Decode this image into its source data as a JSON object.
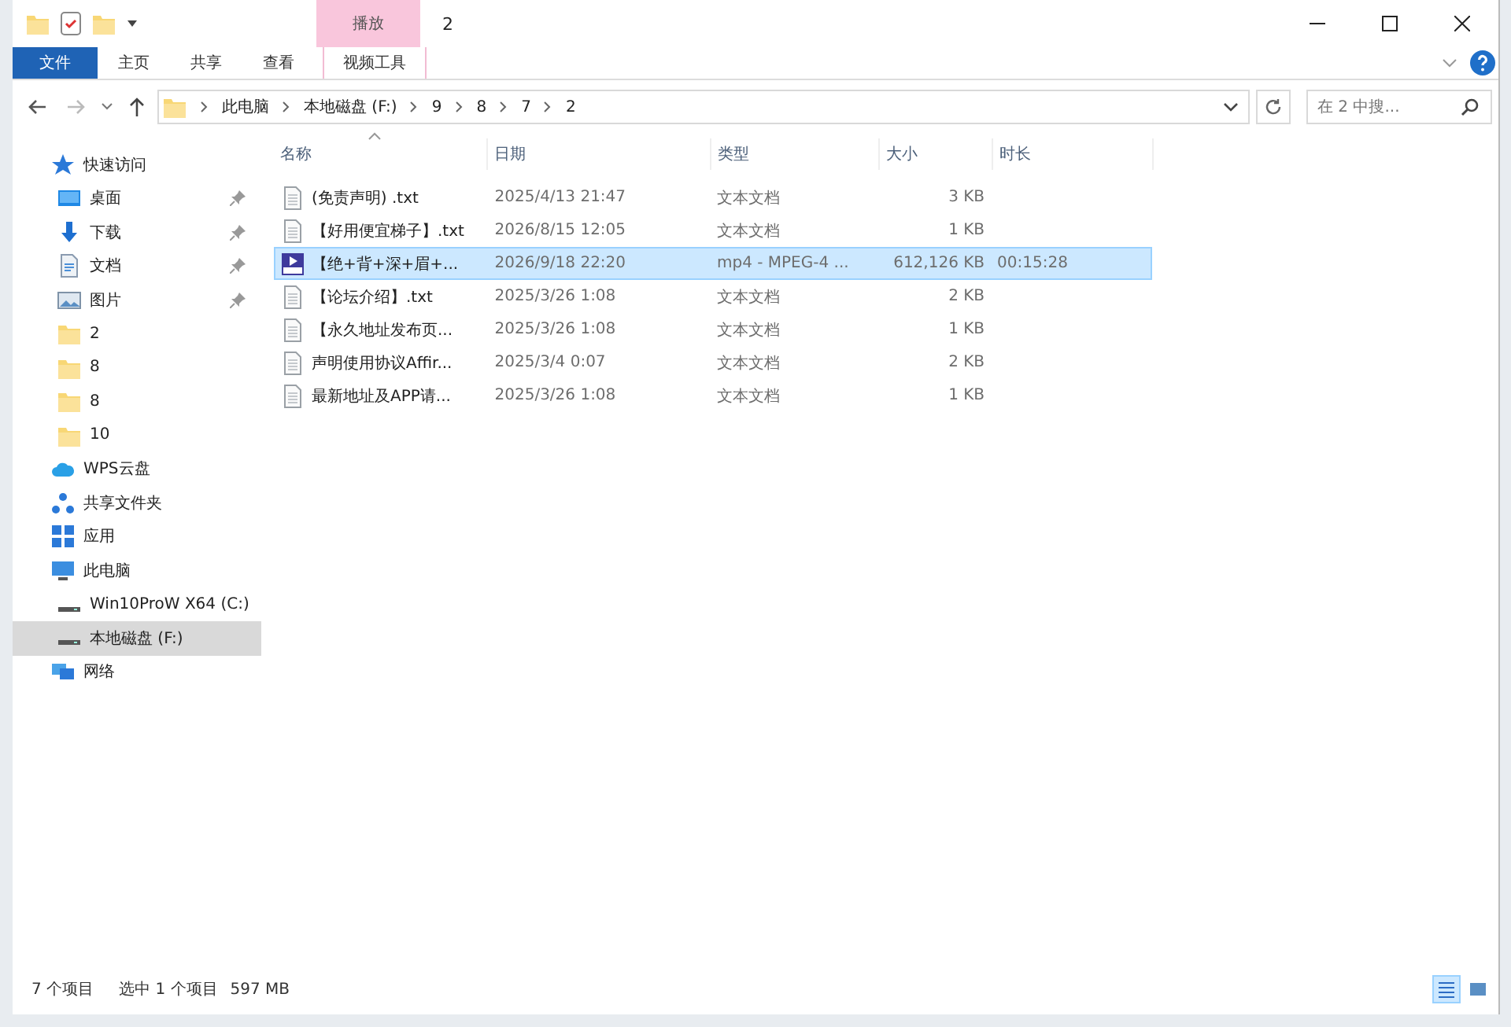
{
  "window": {
    "title": "2",
    "contextual_tab_group": "播放"
  },
  "ribbon_tabs": [
    {
      "label": "文件",
      "kind": "file",
      "selected": false
    },
    {
      "label": "主页",
      "kind": "tab",
      "selected": false
    },
    {
      "label": "共享",
      "kind": "tab",
      "selected": false
    },
    {
      "label": "查看",
      "kind": "tab",
      "selected": false
    },
    {
      "label": "视频工具",
      "kind": "contextual",
      "selected": false
    }
  ],
  "address_bar": {
    "path": [
      "此电脑",
      "本地磁盘 (F:)",
      "9",
      "8",
      "7",
      "2"
    ]
  },
  "search": {
    "placeholder": "在 2 中搜..."
  },
  "sidebar": {
    "items": [
      {
        "label": "快速访问",
        "kind": "star",
        "selected": false,
        "children": [
          {
            "label": "桌面",
            "kind": "desktop",
            "pinned": true,
            "selected": false
          },
          {
            "label": "下载",
            "kind": "download",
            "pinned": true,
            "selected": false
          },
          {
            "label": "文档",
            "kind": "document",
            "pinned": true,
            "selected": false
          },
          {
            "label": "图片",
            "kind": "picture",
            "pinned": true,
            "selected": false
          },
          {
            "label": "2",
            "kind": "folder",
            "pinned": false,
            "selected": false
          },
          {
            "label": "8",
            "kind": "folder",
            "pinned": false,
            "selected": false
          },
          {
            "label": "8",
            "kind": "folder",
            "pinned": false,
            "selected": false
          },
          {
            "label": "10",
            "kind": "folder",
            "pinned": false,
            "selected": false
          }
        ]
      },
      {
        "label": "WPS云盘",
        "kind": "cloud",
        "selected": false
      },
      {
        "label": "共享文件夹",
        "kind": "share",
        "selected": false
      },
      {
        "label": "应用",
        "kind": "apps",
        "selected": false
      },
      {
        "label": "此电脑",
        "kind": "computer",
        "selected": false,
        "children": [
          {
            "label": "Win10ProW X64 (C:)",
            "kind": "drive",
            "pinned": false,
            "selected": false
          },
          {
            "label": "本地磁盘 (F:)",
            "kind": "drive",
            "pinned": false,
            "selected": true
          }
        ]
      },
      {
        "label": "网络",
        "kind": "network",
        "selected": false
      }
    ]
  },
  "table": {
    "columns": [
      "名称",
      "日期",
      "类型",
      "大小",
      "时长"
    ],
    "rows": [
      {
        "kind": "text",
        "selected": false,
        "cells": [
          "(免责声明) .txt",
          "2025/4/13 21:47",
          "文本文档",
          "3 KB",
          ""
        ]
      },
      {
        "kind": "text",
        "selected": false,
        "cells": [
          "【好用便宜梯子】.txt",
          "2026/8/15 12:05",
          "文本文档",
          "1 KB",
          ""
        ]
      },
      {
        "kind": "video",
        "selected": true,
        "cells": [
          "【绝+背+深+眉+...",
          "2026/9/18 22:20",
          "mp4 - MPEG-4 ...",
          "612,126 KB",
          "00:15:28"
        ]
      },
      {
        "kind": "text",
        "selected": false,
        "cells": [
          "【论坛介绍】.txt",
          "2025/3/26 1:08",
          "文本文档",
          "2 KB",
          ""
        ]
      },
      {
        "kind": "text",
        "selected": false,
        "cells": [
          "【永久地址发布页...",
          "2025/3/26 1:08",
          "文本文档",
          "1 KB",
          ""
        ]
      },
      {
        "kind": "text",
        "selected": false,
        "cells": [
          "声明使用协议Affir...",
          "2025/3/4 0:07",
          "文本文档",
          "2 KB",
          ""
        ]
      },
      {
        "kind": "text",
        "selected": false,
        "cells": [
          "最新地址及APP请...",
          "2025/3/26 1:08",
          "文本文档",
          "1 KB",
          ""
        ]
      }
    ]
  },
  "status_bar": {
    "item_count": "7 个项目",
    "selection": "选中 1 个项目",
    "selection_size": "597 MB"
  }
}
